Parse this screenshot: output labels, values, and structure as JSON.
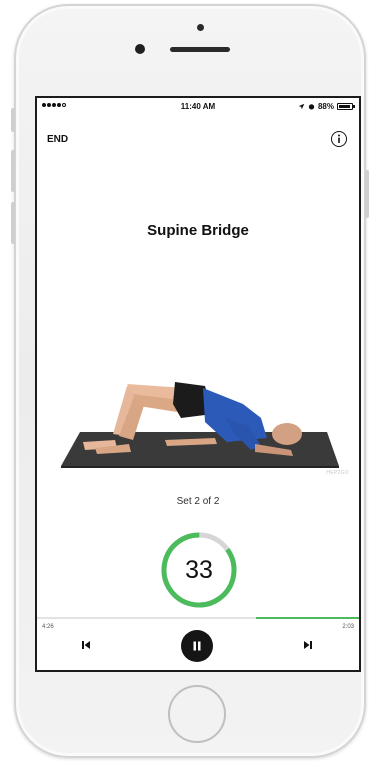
{
  "status_bar": {
    "time": "11:40 AM",
    "battery": "88%",
    "icons": [
      "signal-dots-icon",
      "location-arrow-icon",
      "alarm-icon",
      "battery-icon"
    ]
  },
  "header": {
    "end_label": "END",
    "info_icon": "info-circle-icon"
  },
  "exercise": {
    "title": "Supine Bridge",
    "watermark": "HEP2GO",
    "set_text": "Set 2 of 2"
  },
  "timer": {
    "value": "33",
    "progress_fraction": 0.85,
    "accent_color": "#4cbb5c",
    "track_color": "#d6d6d6"
  },
  "playback": {
    "elapsed": "4:26",
    "remaining": "2:03",
    "progress_fraction": 0.32,
    "prev_icon": "skip-previous-icon",
    "pause_icon": "pause-icon",
    "next_icon": "skip-next-icon"
  }
}
